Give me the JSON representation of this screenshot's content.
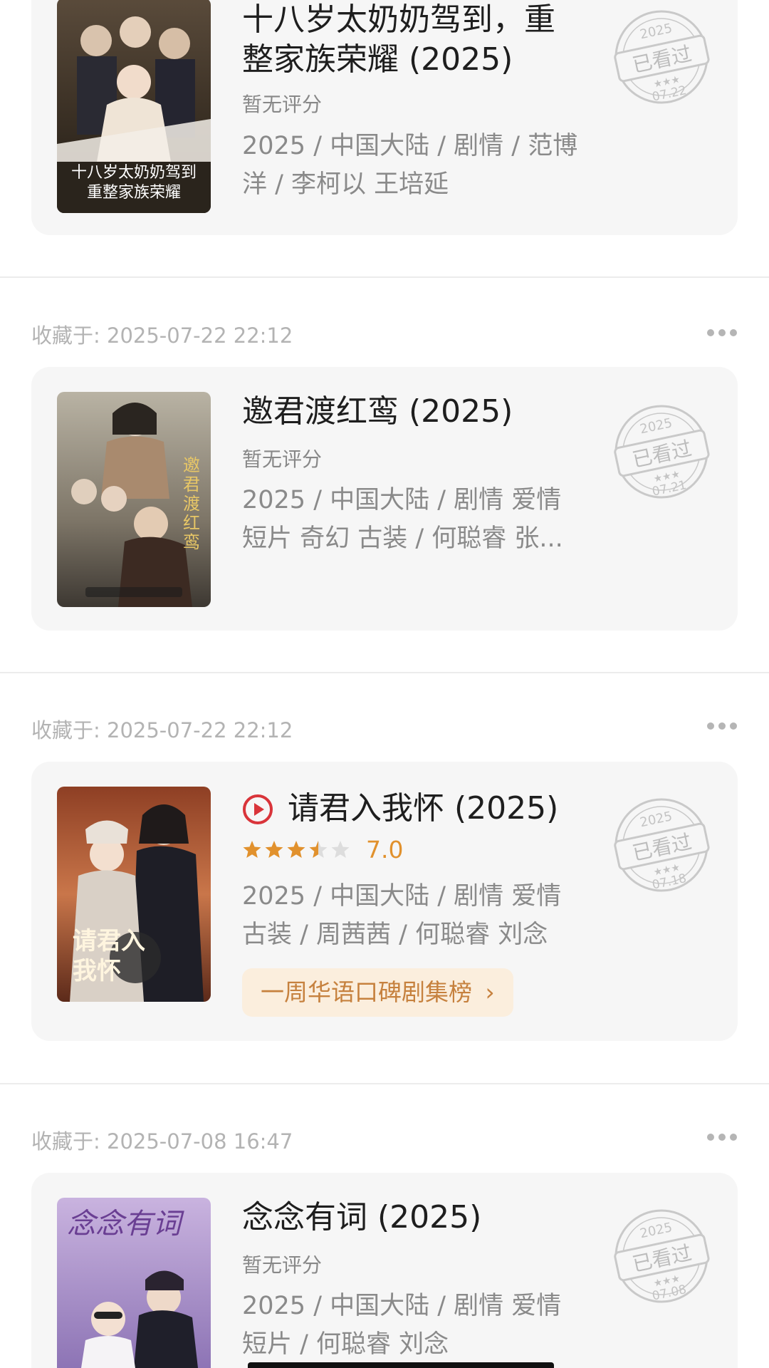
{
  "entries": [
    {
      "saved_label": "",
      "title": "十八岁太奶奶驾到，重整家族荣耀 (2025)",
      "title_line1": "十八岁太奶奶驾到，重",
      "title_line2": "整家族荣耀 (2025)",
      "rating_text": "暂无评分",
      "meta_line1": "2025 / 中国大陆 / 剧情 / 范博",
      "meta_line2": "洋 / 李柯以 王培延",
      "poster_text": "十八岁太奶奶驾到 重整家族荣耀",
      "stamp": {
        "year": "2025",
        "label": "已看过",
        "date": "07.22"
      }
    },
    {
      "saved_label": "收藏于: 2025-07-22 22:12",
      "title": "邀君渡红鸾 (2025)",
      "rating_text": "暂无评分",
      "meta_line1": "2025 / 中国大陆 / 剧情 爱情",
      "meta_line2": "短片 奇幻 古装 / 何聪睿 张...",
      "poster_text": "邀君渡红鸾",
      "stamp": {
        "year": "2025",
        "label": "已看过",
        "date": "07.21"
      }
    },
    {
      "saved_label": "收藏于: 2025-07-22 22:12",
      "title": "请君入我怀 (2025)",
      "rating_value": "7.0",
      "rating_stars": 3.5,
      "meta_line1": "2025 / 中国大陆 / 剧情 爱情",
      "meta_line2": "古装 / 周茜茜 / 何聪睿 刘念",
      "rank_label": "一周华语口碑剧集榜",
      "poster_text": "请君入我怀",
      "stamp": {
        "year": "2025",
        "label": "已看过",
        "date": "07.18"
      }
    },
    {
      "saved_label": "收藏于: 2025-07-08 16:47",
      "title": "念念有词 (2025)",
      "rating_text": "暂无评分",
      "meta_line1": "2025 / 中国大陆 / 剧情 爱情",
      "meta_line2": "短片 / 何聪睿 刘念",
      "poster_text": "念念有词",
      "stamp": {
        "year": "2025",
        "label": "已看过",
        "date": "07.08"
      }
    }
  ],
  "icons": {
    "more": "more-dots-icon",
    "play": "play-circle-icon",
    "rank_arrow": "chevron-right-icon",
    "star": "star-icon"
  },
  "colors": {
    "accent_orange": "#e1912d",
    "play_red": "#d9343a",
    "rank_bg": "#fbeedd",
    "rank_text": "#c6813e"
  }
}
